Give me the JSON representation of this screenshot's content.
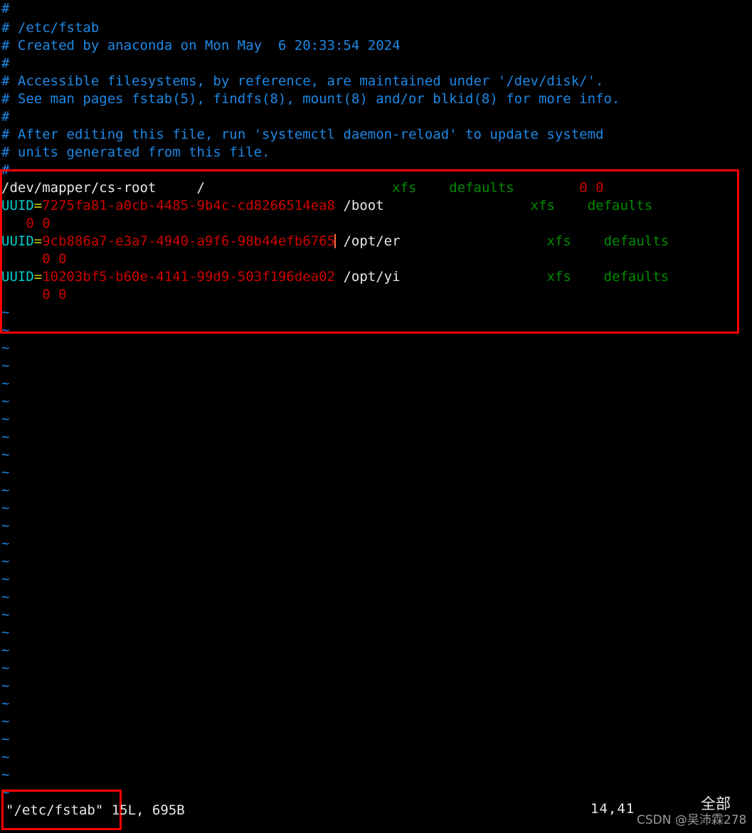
{
  "app": {
    "name": "vim",
    "file": "/etc/fstab",
    "background": "#000000"
  },
  "colors": {
    "comment": "#1e88e5",
    "text": "#e8e8e8",
    "uuid_key": "#00cdcd",
    "operator": "#cdcd00",
    "uuid_value": "#cd0000",
    "fs_type": "#008b00",
    "options": "#008b00",
    "dump_pass": "#cd0000",
    "tilde": "#1e88e5",
    "annotation": "#ff0000",
    "cursor": "#ff6a3d"
  },
  "buffer": {
    "comments": [
      "#",
      "# /etc/fstab",
      "# Created by anaconda on Mon May  6 20:33:54 2024",
      "#",
      "# Accessible filesystems, by reference, are maintained under '/dev/disk/'.",
      "# See man pages fstab(5), findfs(8), mount(8) and/or blkid(8) for more info.",
      "#",
      "# After editing this file, run 'systemctl daemon-reload' to update systemd",
      "# units generated from this file.",
      "#"
    ],
    "entries": [
      {
        "device": "/dev/mapper/cs-root",
        "device_pad": "     ",
        "mountpoint": "/",
        "mount_pad": "                       ",
        "fstype": "xfs",
        "fstype_pad": "    ",
        "options": "defaults",
        "options_pad": "        ",
        "dump_pass": "0 0",
        "wrapped": false,
        "uuid_prefix": "",
        "uuid_op": "",
        "uuid_value": ""
      },
      {
        "device": "",
        "uuid_prefix": "UUID",
        "uuid_op": "=",
        "uuid_value": "7275fa81-a0cb-4485-9b4c-cd8266514ea8",
        "mountpoint": "/boot",
        "mount_pad": "                  ",
        "fstype": "xfs",
        "fstype_pad": "    ",
        "options": "defaults",
        "wrapped": true,
        "wrap_indent": "   ",
        "dump_pass": "0 0"
      },
      {
        "device": "",
        "uuid_prefix": "UUID",
        "uuid_op": "=",
        "uuid_value": "9cb886a7-e3a7-4940-a9f6-98b44efb6765",
        "cursor_before_last_char": true,
        "mountpoint": "/opt/er",
        "mount_pad": "                  ",
        "fstype": "xfs",
        "fstype_pad": "    ",
        "options": "defaults",
        "wrapped": true,
        "wrap_indent": "     ",
        "dump_pass": "0 0"
      },
      {
        "device": "",
        "uuid_prefix": "UUID",
        "uuid_op": "=",
        "uuid_value": "10203bf5-b60e-4141-99d9-503f196dea02",
        "mountpoint": "/opt/yi",
        "mount_pad": "                  ",
        "fstype": "xfs",
        "fstype_pad": "    ",
        "options": "defaults",
        "wrapped": true,
        "wrap_indent": "     ",
        "dump_pass": "0 0"
      }
    ],
    "empty_marker": "~",
    "empty_marker_count": 28
  },
  "status": {
    "filename": "\"/etc/fstab\" 15L, 695B",
    "ruler": "14,41",
    "mode": "全部"
  },
  "watermark": {
    "text": "CSDN @吴沛霖278"
  },
  "annotations": [
    {
      "name": "fstab-entries-highlight"
    },
    {
      "name": "filename-highlight"
    }
  ]
}
